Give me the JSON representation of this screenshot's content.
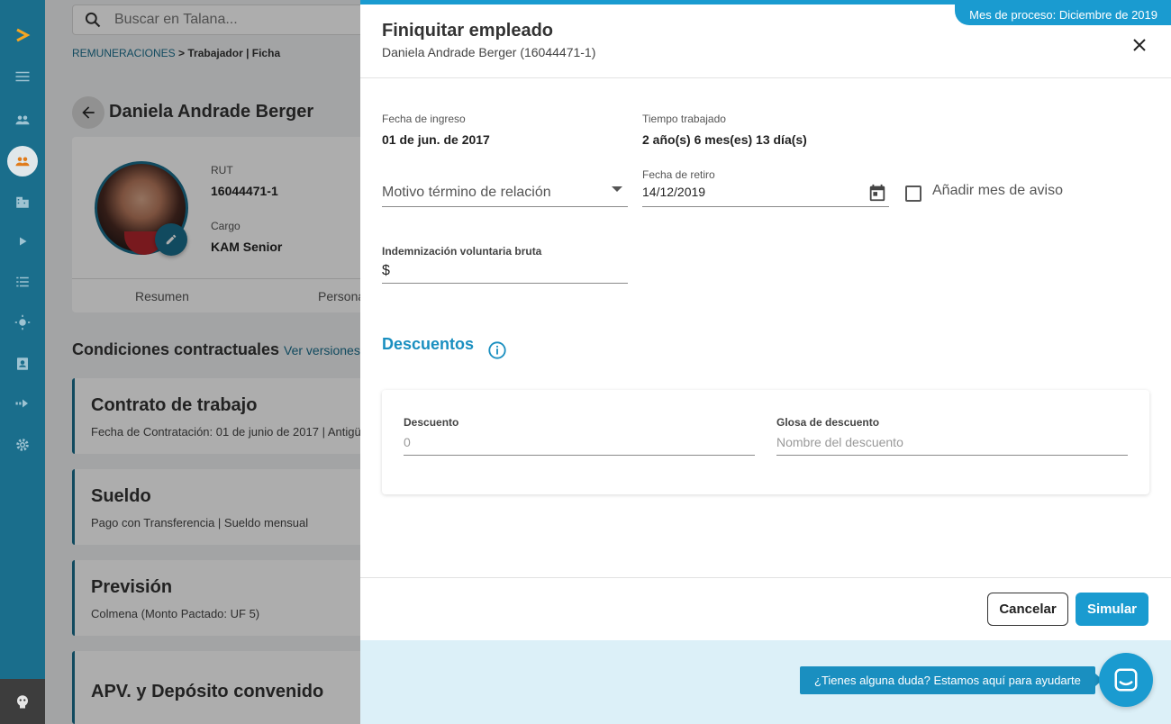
{
  "colors": {
    "rail": "#1a6e8c",
    "accent": "#1a9bd0",
    "brand_logo": "#f5a623"
  },
  "search": {
    "placeholder": "Buscar en Talana..."
  },
  "breadcrumb": {
    "section": "REMUNERACIONES",
    "separator": ">",
    "path": "Trabajador | Ficha"
  },
  "employee": {
    "name": "Daniela Andrade Berger",
    "rut_label": "RUT",
    "rut": "16044471-1",
    "cargo_label": "Cargo",
    "cargo": "KAM Senior",
    "tabs": [
      "Resumen",
      "Persona"
    ]
  },
  "conditions": {
    "title": "Condiciones contractuales",
    "link": "Ver versiones",
    "cards": [
      {
        "title": "Contrato de trabajo",
        "subtitle": "Fecha de Contratación: 01 de junio de 2017 | Antigü"
      },
      {
        "title": "Sueldo",
        "subtitle": "Pago con Transferencia | Sueldo mensual"
      },
      {
        "title": "Previsión",
        "subtitle": "Colmena (Monto Pactado: UF 5)"
      },
      {
        "title": "APV. y Depósito convenido",
        "subtitle": ""
      }
    ]
  },
  "modal": {
    "process_badge": "Mes de proceso: Diciembre de 2019",
    "title": "Finiquitar empleado",
    "subtitle": "Daniela Andrade Berger (16044471-1)",
    "fecha_ingreso_label": "Fecha de ingreso",
    "fecha_ingreso": "01 de jun. de 2017",
    "tiempo_label": "Tiempo trabajado",
    "tiempo": "2 año(s) 6 mes(es) 13 día(s)",
    "motivo_placeholder": "Motivo término de relación",
    "fecha_retiro_label": "Fecha de retiro",
    "fecha_retiro": "14/12/2019",
    "aviso_label": "Añadir mes de aviso",
    "indemnizacion_label": "Indemnización voluntaria bruta",
    "indemnizacion_prefix": "$",
    "descuentos_title": "Descuentos",
    "descuento_label": "Descuento",
    "descuento_placeholder": "0",
    "glosa_label": "Glosa de descuento",
    "glosa_placeholder": "Nombre del descuento",
    "cancel": "Cancelar",
    "simulate": "Simular"
  },
  "help": {
    "text": "¿Tienes alguna duda? Estamos aquí para ayudarte"
  }
}
